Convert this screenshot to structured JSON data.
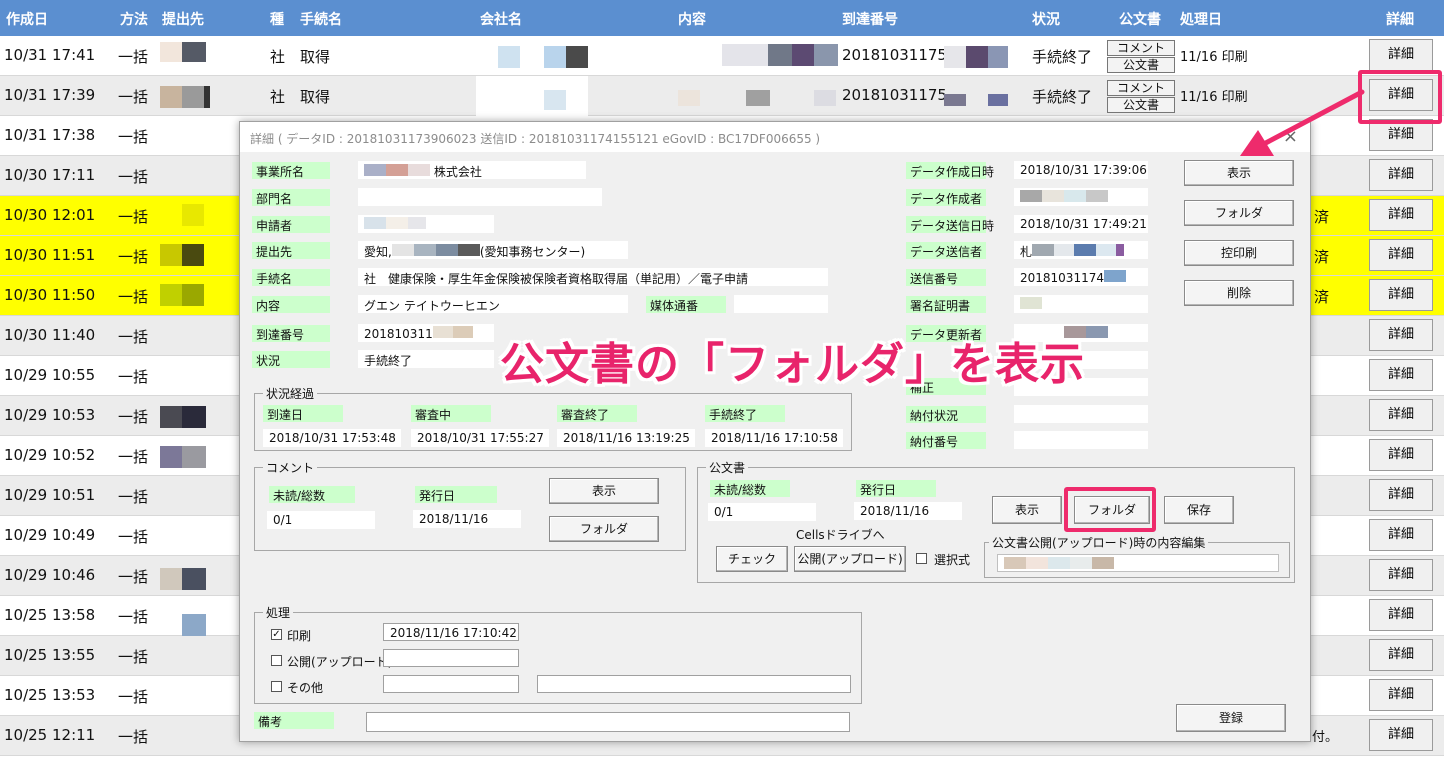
{
  "table": {
    "headers": {
      "created": "作成日",
      "method": "方法",
      "dest": "提出先",
      "type": "種",
      "procedure": "手続名",
      "company": "会社名",
      "content": "内容",
      "arrival": "到達番号",
      "status": "状況",
      "doc": "公文書",
      "processed": "処理日",
      "detail": "詳細"
    },
    "rows": [
      {
        "date": "10/31 17:41",
        "method": "一括",
        "type": "社",
        "proc": "取得",
        "arrival": "20181031175",
        "status": "手続終了",
        "comment_btn": "コメント",
        "doc_btn": "公文書",
        "processed": "11/16 印刷",
        "detail": "詳細"
      },
      {
        "date": "10/31 17:39",
        "method": "一括",
        "type": "社",
        "proc": "取得",
        "arrival": "20181031175",
        "status": "手続終了",
        "comment_btn": "コメント",
        "doc_btn": "公文書",
        "processed": "11/16 印刷",
        "detail": "詳細"
      },
      {
        "date": "10/31 17:38",
        "method": "一括",
        "detail": "詳細"
      },
      {
        "date": "10/30 17:11",
        "method": "一括",
        "detail": "詳細"
      },
      {
        "date": "10/30 12:01",
        "method": "一括",
        "right": "済",
        "detail": "詳細"
      },
      {
        "date": "10/30 11:51",
        "method": "一括",
        "right": "済",
        "detail": "詳細"
      },
      {
        "date": "10/30 11:50",
        "method": "一括",
        "right": "済",
        "detail": "詳細"
      },
      {
        "date": "10/30 11:40",
        "method": "一括",
        "detail": "詳細"
      },
      {
        "date": "10/29 10:55",
        "method": "一括",
        "detail": "詳細"
      },
      {
        "date": "10/29 10:53",
        "method": "一括",
        "detail": "詳細"
      },
      {
        "date": "10/29 10:52",
        "method": "一括",
        "detail": "詳細"
      },
      {
        "date": "10/29 10:51",
        "method": "一括",
        "detail": "詳細"
      },
      {
        "date": "10/29 10:49",
        "method": "一括",
        "detail": "詳細"
      },
      {
        "date": "10/29 10:46",
        "method": "一括",
        "detail": "詳細"
      },
      {
        "date": "10/25 13:58",
        "method": "一括",
        "detail": "詳細"
      },
      {
        "date": "10/25 13:55",
        "method": "一括",
        "detail": "詳細"
      },
      {
        "date": "10/25 13:53",
        "method": "一括",
        "detail": "詳細"
      },
      {
        "date": "10/25 12:11",
        "method": "一括",
        "right": "付。",
        "detail": "詳細"
      }
    ]
  },
  "dialog": {
    "title": "詳細 ( データID : 20181031173906023 送信ID : 20181031174155121 eGovID : BC17DF006655 )",
    "close": "×",
    "left_fields": {
      "office_label": "事業所名",
      "office_value": "株式会社",
      "dept_label": "部門名",
      "applicant_label": "申請者",
      "dest_label": "提出先",
      "dest_value_pre": "愛知,",
      "dest_value_post": "(愛知事務センター)",
      "proc_label": "手続名",
      "proc_value": "社　健康保険・厚生年金保険被保険者資格取得届（単記用）／電子申請",
      "content_label": "内容",
      "content_value": "グエン テイトウーヒエン",
      "media_label": "媒体通番",
      "arrival_label": "到達番号",
      "arrival_value": "201810311",
      "status_label": "状況",
      "status_value": "手続終了"
    },
    "right_fields": {
      "created_dt_label": "データ作成日時",
      "created_dt_value": "2018/10/31 17:39:06",
      "creator_label": "データ作成者",
      "sent_dt_label": "データ送信日時",
      "sent_dt_value": "2018/10/31 17:49:21",
      "sender_label": "データ送信者",
      "sender_value": "札",
      "send_no_label": "送信番号",
      "send_no_value": "20181031174",
      "cert_label": "署名証明書",
      "updated_label": "データ更新者",
      "note_label": "補正",
      "pay_status_label": "納付状況",
      "pay_no_label": "納付番号"
    },
    "side_buttons": {
      "show": "表示",
      "folder": "フォルダ",
      "copy_print": "控印刷",
      "delete": "削除"
    },
    "progress": {
      "title": "状況経過",
      "cols": [
        {
          "label": "到達日",
          "value": "2018/10/31 17:53:48"
        },
        {
          "label": "審査中",
          "value": "2018/10/31 17:55:27"
        },
        {
          "label": "審査終了",
          "value": "2018/11/16 13:19:25"
        },
        {
          "label": "手続終了",
          "value": "2018/11/16 17:10:58"
        }
      ]
    },
    "comment": {
      "title": "コメント",
      "unread_label": "未読/総数",
      "unread_value": "0/1",
      "issued_label": "発行日",
      "issued_value": "2018/11/16",
      "show_btn": "表示",
      "folder_btn": "フォルダ"
    },
    "official": {
      "title": "公文書",
      "unread_label": "未読/総数",
      "unread_value": "0/1",
      "issued_label": "発行日",
      "issued_value": "2018/11/16",
      "show_btn": "表示",
      "folder_btn": "フォルダ",
      "save_btn": "保存",
      "cells_label": "Cellsドライブへ",
      "check_btn": "チェック",
      "publish_btn": "公開(アップロード)",
      "select_label": "選択式",
      "edit_group_title": "公文書公開(アップロード)時の内容編集"
    },
    "process": {
      "title": "処理",
      "print_label": "印刷",
      "print_checked": true,
      "print_value": "2018/11/16 17:10:42",
      "publish_label": "公開(アップロード)",
      "publish_checked": false,
      "other_label": "その他",
      "other_checked": false
    },
    "remarks_label": "備考",
    "register_btn": "登録"
  },
  "callout": "公文書の「フォルダ」を表示",
  "colors": {
    "header_bg": "#5b8fd0",
    "highlight_row": "#ffff00",
    "label_bg": "#ccffcc",
    "accent": "#ee2b6c"
  }
}
